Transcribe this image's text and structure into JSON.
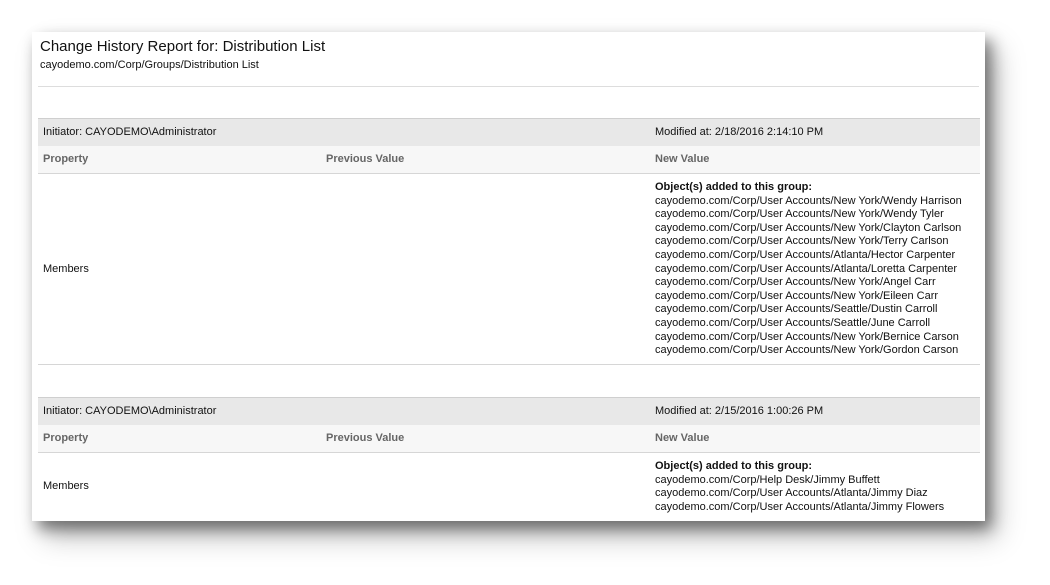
{
  "report": {
    "title": "Change History Report for: Distribution List",
    "path": "cayodemo.com/Corp/Groups/Distribution List"
  },
  "columns": {
    "property": "Property",
    "previous": "Previous Value",
    "new": "New Value"
  },
  "entries": [
    {
      "initiator": "Initiator: CAYODEMO\\Administrator",
      "modified": "Modified at: 2/18/2016 2:14:10 PM",
      "property": "Members",
      "previous_value": "",
      "new_value_heading": "Object(s) added to this group:",
      "new_values": [
        "cayodemo.com/Corp/User Accounts/New York/Wendy Harrison",
        "cayodemo.com/Corp/User Accounts/New York/Wendy Tyler",
        "cayodemo.com/Corp/User Accounts/New York/Clayton Carlson",
        "cayodemo.com/Corp/User Accounts/New York/Terry Carlson",
        "cayodemo.com/Corp/User Accounts/Atlanta/Hector Carpenter",
        "cayodemo.com/Corp/User Accounts/Atlanta/Loretta Carpenter",
        "cayodemo.com/Corp/User Accounts/New York/Angel Carr",
        "cayodemo.com/Corp/User Accounts/New York/Eileen Carr",
        "cayodemo.com/Corp/User Accounts/Seattle/Dustin Carroll",
        "cayodemo.com/Corp/User Accounts/Seattle/June Carroll",
        "cayodemo.com/Corp/User Accounts/New York/Bernice Carson",
        "cayodemo.com/Corp/User Accounts/New York/Gordon Carson"
      ]
    },
    {
      "initiator": "Initiator: CAYODEMO\\Administrator",
      "modified": "Modified at: 2/15/2016 1:00:26 PM",
      "property": "Members",
      "previous_value": "",
      "new_value_heading": "Object(s) added to this group:",
      "new_values": [
        "cayodemo.com/Corp/Help Desk/Jimmy Buffett",
        "cayodemo.com/Corp/User Accounts/Atlanta/Jimmy Diaz",
        "cayodemo.com/Corp/User Accounts/Atlanta/Jimmy Flowers"
      ]
    }
  ]
}
